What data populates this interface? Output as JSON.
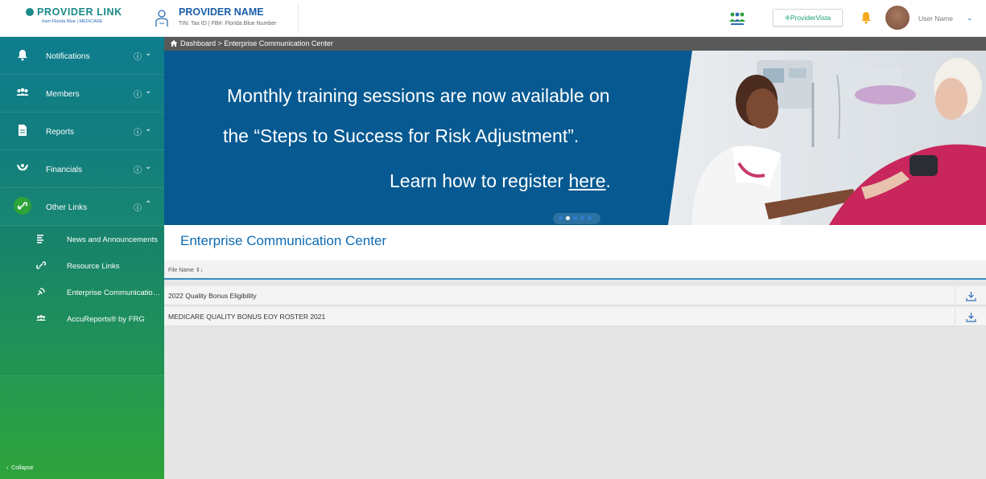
{
  "header": {
    "logo_text": "PROVIDER LINK",
    "logo_sub": "from Florida Blue | MEDICARE",
    "provider_name": "PROVIDER NAME",
    "provider_tin": "TIN: Tax ID  |  FB#: Florida Blue Number",
    "provider_vista_label": "ProviderVista",
    "user_name": "User Name"
  },
  "sidebar": {
    "items": [
      {
        "label": "Notifications",
        "icon": "bell-icon"
      },
      {
        "label": "Members",
        "icon": "members-icon"
      },
      {
        "label": "Reports",
        "icon": "report-icon"
      },
      {
        "label": "Financials",
        "icon": "financials-icon"
      },
      {
        "label": "Other Links",
        "icon": "link-icon"
      }
    ],
    "sub_items": [
      {
        "label": "News and Announcements",
        "icon": "list-icon"
      },
      {
        "label": "Resource Links",
        "icon": "link-icon"
      },
      {
        "label": "Enterprise Communication Center",
        "icon": "satellite-icon"
      },
      {
        "label": "AccuReports® by FRG",
        "icon": "members-icon"
      }
    ],
    "collapse_label": "Collapse"
  },
  "breadcrumb": {
    "text": "Dashboard  >  Enterprise Communication Center"
  },
  "banner": {
    "line1": "Monthly training sessions are now available on",
    "line2": "the “Steps to Success for Risk Adjustment”.",
    "line3_prefix": "Learn how to register ",
    "line3_link": "here",
    "line3_suffix": ".",
    "slides_total": 5,
    "slide_active": 2
  },
  "main": {
    "title": "Enterprise Communication Center",
    "column_header": "File Name",
    "rows": [
      {
        "label": "2022 Quality Bonus Eligibility"
      },
      {
        "label": "MEDICARE QUALITY BONUS EOY ROSTER 2021"
      }
    ]
  },
  "colors": {
    "brand_teal": "#1a8a8a",
    "brand_blue": "#0e6bb2",
    "banner_blue": "#065991",
    "sidebar_top": "#0e7d8d",
    "sidebar_bottom": "#2ea33a",
    "bell_orange": "#f4a81c"
  }
}
